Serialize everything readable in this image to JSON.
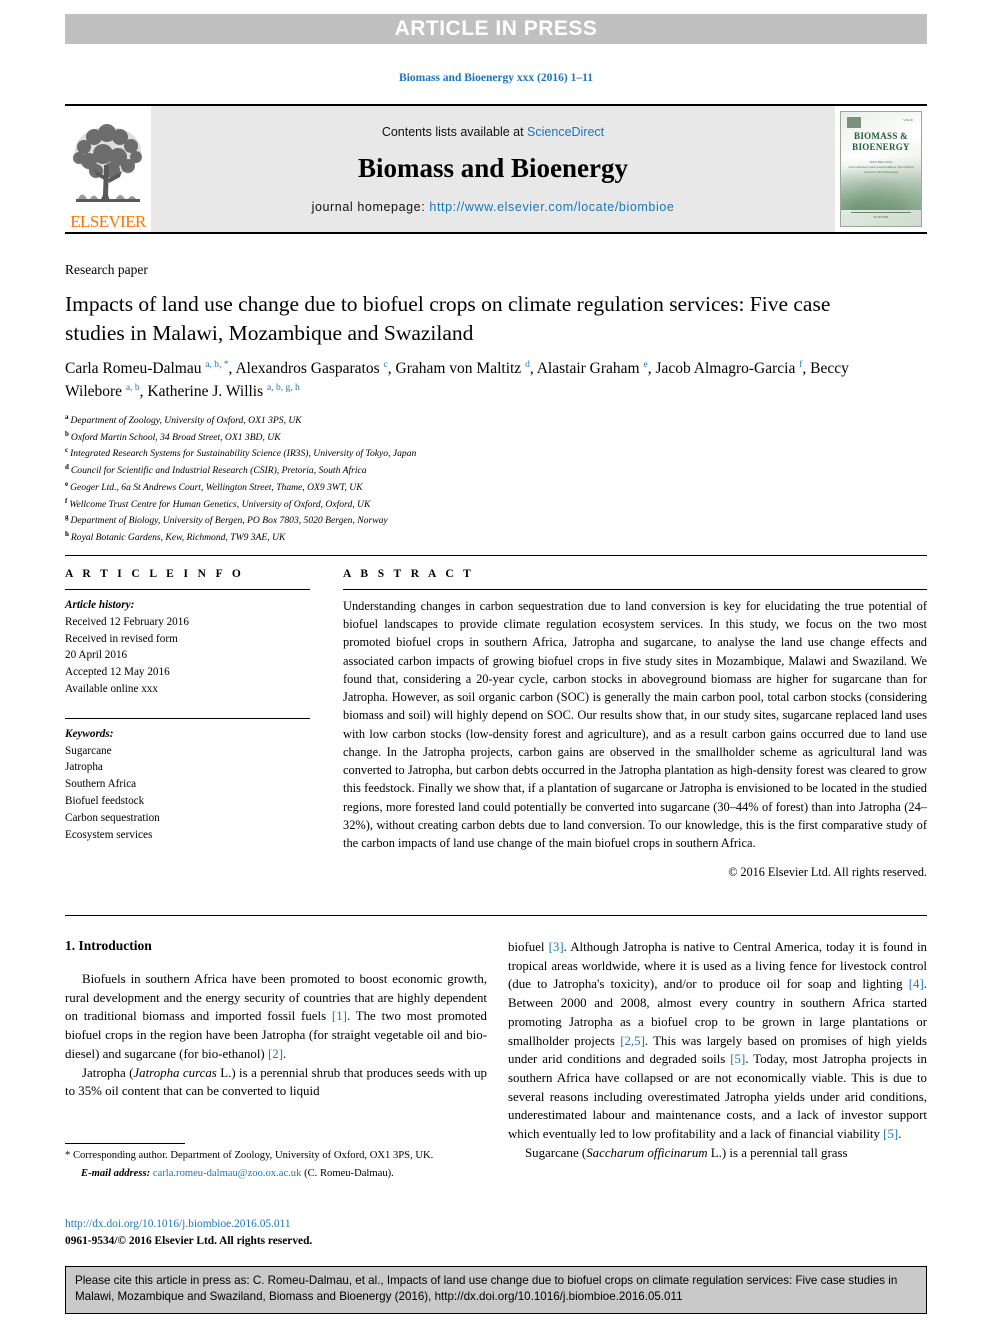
{
  "banner": {
    "text": "ARTICLE IN PRESS"
  },
  "journal_ref": "Biomass and Bioenergy xxx (2016) 1–11",
  "masthead": {
    "contents_prefix": "Contents lists available at ",
    "sciencedirect": "ScienceDirect",
    "journal_title": "Biomass and Bioenergy",
    "homepage_label": "journal homepage: ",
    "homepage_url": "http://www.elsevier.com/locate/biombioe",
    "publisher": "ELSEVIER",
    "cover": {
      "title": "BIOMASS & BIOENERGY",
      "subtitle": "ISSN 0961-9534\nwww.elsevier.com/locate/biombioe\nThe Official Journal of IEA Bioenergy",
      "footer": "ELSEVIER"
    }
  },
  "accent_blue": "#1b75bb",
  "elsevier_orange": "#ff7300",
  "doctype": "Research paper",
  "title": "Impacts of land use change due to biofuel crops on climate regulation services: Five case studies in Malawi, Mozambique and Swaziland",
  "authors": [
    {
      "name": "Carla Romeu-Dalmau",
      "marks": "a, b, *",
      "sep": ", "
    },
    {
      "name": "Alexandros Gasparatos",
      "marks": "c",
      "sep": ", "
    },
    {
      "name": "Graham von Maltitz",
      "marks": "d",
      "sep": ", "
    },
    {
      "name": "Alastair Graham",
      "marks": "e",
      "sep": ", "
    },
    {
      "name": "Jacob Almagro-Garcia",
      "marks": "f",
      "sep": ", "
    },
    {
      "name": "Beccy Wilebore",
      "marks": "a, b",
      "sep": ", "
    },
    {
      "name": "Katherine J. Willis",
      "marks": "a, b, g, h",
      "sep": ""
    }
  ],
  "affiliations": [
    {
      "marker": "a",
      "text": "Department of Zoology, University of Oxford, OX1 3PS, UK"
    },
    {
      "marker": "b",
      "text": "Oxford Martin School, 34 Broad Street, OX1 3BD, UK"
    },
    {
      "marker": "c",
      "text": "Integrated Research Systems for Sustainability Science (IR3S), University of Tokyo, Japan"
    },
    {
      "marker": "d",
      "text": "Council for Scientific and Industrial Research (CSIR), Pretoria, South Africa"
    },
    {
      "marker": "e",
      "text": "Geoger Ltd., 6a St Andrews Court, Wellington Street, Thame, OX9 3WT, UK"
    },
    {
      "marker": "f",
      "text": "Wellcome Trust Centre for Human Genetics, University of Oxford, Oxford, UK"
    },
    {
      "marker": "g",
      "text": "Department of Biology, University of Bergen, PO Box 7803, 5020 Bergen, Norway"
    },
    {
      "marker": "h",
      "text": "Royal Botanic Gardens, Kew, Richmond, TW9 3AE, UK"
    }
  ],
  "article_info": {
    "heading": "A R T I C L E   I N F O",
    "history_label": "Article history:",
    "history": [
      "Received 12 February 2016",
      "Received in revised form",
      "20 April 2016",
      "Accepted 12 May 2016",
      "Available online xxx"
    ],
    "keywords_label": "Keywords:",
    "keywords": [
      "Sugarcane",
      "Jatropha",
      "Southern Africa",
      "Biofuel feedstock",
      "Carbon sequestration",
      "Ecosystem services"
    ]
  },
  "abstract": {
    "heading": "A B S T R A C T",
    "text": "Understanding changes in carbon sequestration due to land conversion is key for elucidating the true potential of biofuel landscapes to provide climate regulation ecosystem services. In this study, we focus on the two most promoted biofuel crops in southern Africa, Jatropha and sugarcane, to analyse the land use change effects and associated carbon impacts of growing biofuel crops in five study sites in Mozambique, Malawi and Swaziland. We found that, considering a 20-year cycle, carbon stocks in aboveground biomass are higher for sugarcane than for Jatropha. However, as soil organic carbon (SOC) is generally the main carbon pool, total carbon stocks (considering biomass and soil) will highly depend on SOC. Our results show that, in our study sites, sugarcane replaced land uses with low carbon stocks (low-density forest and agriculture), and as a result carbon gains occurred due to land use change. In the Jatropha projects, carbon gains are observed in the smallholder scheme as agricultural land was converted to Jatropha, but carbon debts occurred in the Jatropha plantation as high-density forest was cleared to grow this feedstock. Finally we show that, if a plantation of sugarcane or Jatropha is envisioned to be located in the studied regions, more forested land could potentially be converted into sugarcane (30–44% of forest) than into Jatropha (24–32%), without creating carbon debts due to land conversion. To our knowledge, this is the first comparative study of the carbon impacts of land use change of the main biofuel crops in southern Africa.",
    "copyright": "© 2016 Elsevier Ltd. All rights reserved."
  },
  "introduction": {
    "heading": "1. Introduction",
    "left_para1_a": "Biofuels in southern Africa have been promoted to boost economic growth, rural development and the energy security of countries that are highly dependent on traditional biomass and imported fossil fuels ",
    "left_cite1": "[1]",
    "left_para1_b": ". The two most promoted biofuel crops in the region have been Jatropha (for straight vegetable oil and bio-diesel) and sugarcane (for bio-ethanol) ",
    "left_cite2": "[2]",
    "left_para1_c": ".",
    "left_para2_a": "Jatropha (",
    "left_para2_italic": "Jatropha curcas",
    "left_para2_b": " L.) is a perennial shrub that produces seeds with up to 35% oil content that can be converted to liquid",
    "right_a": "biofuel ",
    "right_cite3": "[3]",
    "right_b": ". Although Jatropha is native to Central America, today it is found in tropical areas worldwide, where it is used as a living fence for livestock control (due to Jatropha's toxicity), and/or to produce oil for soap and lighting ",
    "right_cite4": "[4]",
    "right_c": ". Between 2000 and 2008, almost every country in southern Africa started promoting Jatropha as a biofuel crop to be grown in large plantations or smallholder projects ",
    "right_cite5": "[2,5]",
    "right_d": ". This was largely based on promises of high yields under arid conditions and degraded soils ",
    "right_cite6": "[5]",
    "right_e": ". Today, most Jatropha projects in southern Africa have collapsed or are not economically viable. This is due to several reasons including overestimated Jatropha yields under arid conditions, underestimated labour and maintenance costs, and a lack of investor support which eventually led to low profitability and a lack of financial viability ",
    "right_cite7": "[5]",
    "right_f": ".",
    "right_para2_a": "Sugarcane (",
    "right_para2_italic": "Saccharum officinarum",
    "right_para2_b": " L.) is a perennial tall grass"
  },
  "footnotes": {
    "corresponding": "* Corresponding author. Department of Zoology, University of Oxford, OX1 3PS, UK.",
    "email_label": "E-mail address:",
    "email": "carla.romeu-dalmau@zoo.ox.ac.uk",
    "email_suffix": "(C. Romeu-Dalmau)."
  },
  "doi_block": {
    "doi": "http://dx.doi.org/10.1016/j.biombioe.2016.05.011",
    "issn": "0961-9534/© 2016 Elsevier Ltd. All rights reserved."
  },
  "citation_box": {
    "text": "Please cite this article in press as: C. Romeu-Dalmau, et al., Impacts of land use change due to biofuel crops on climate regulation services: Five case studies in Malawi, Mozambique and Swaziland, Biomass and Bioenergy (2016), http://dx.doi.org/10.1016/j.biombioe.2016.05.011"
  }
}
